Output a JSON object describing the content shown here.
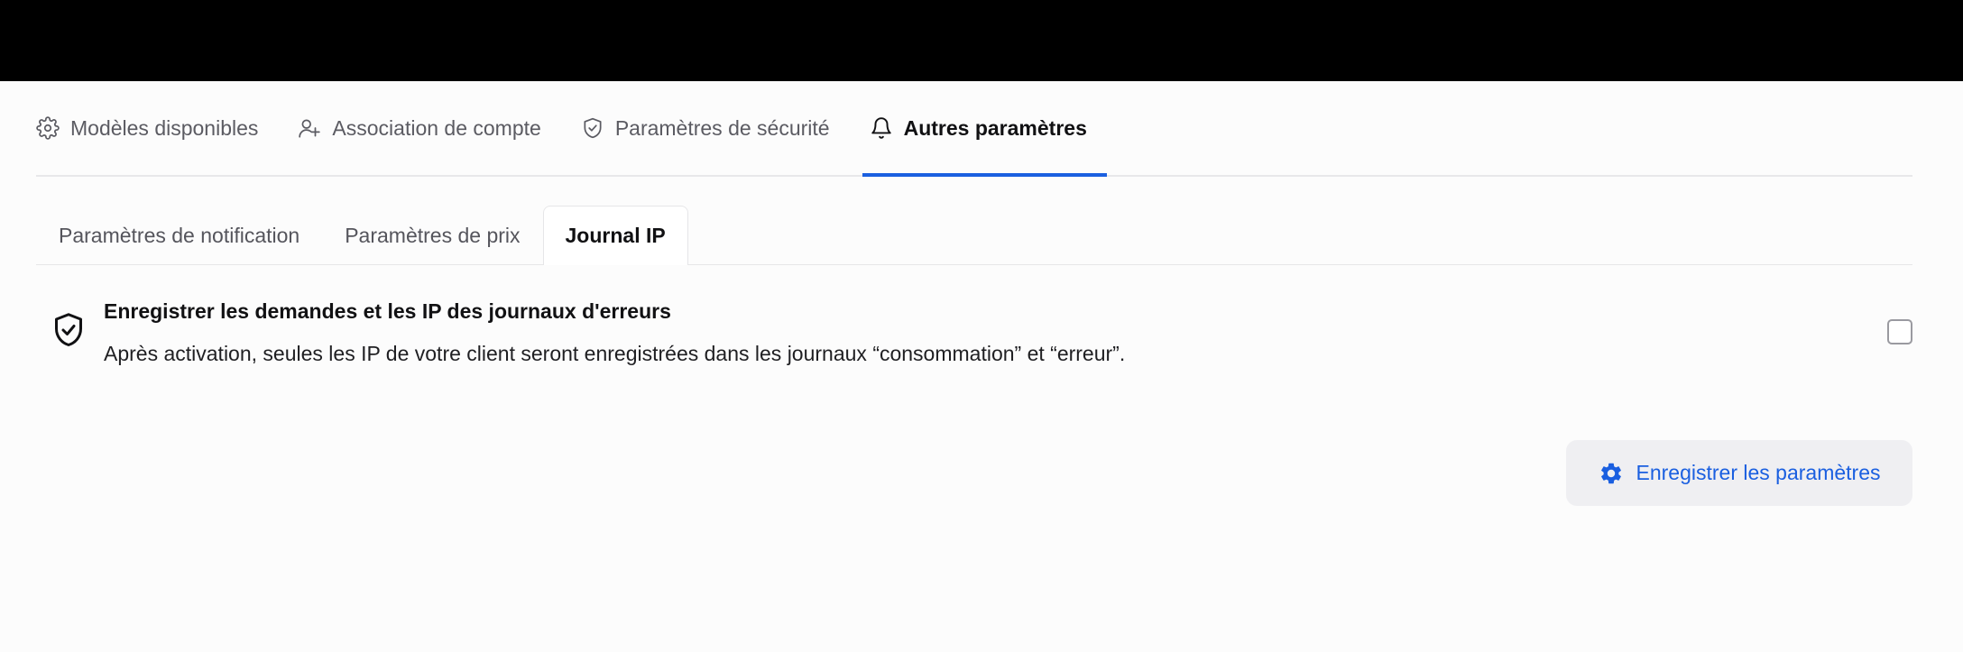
{
  "main_tabs": [
    {
      "label": "Modèles disponibles",
      "icon": "gear-icon",
      "active": false
    },
    {
      "label": "Association de compte",
      "icon": "user-plus-icon",
      "active": false
    },
    {
      "label": "Paramètres de sécurité",
      "icon": "shield-check-icon",
      "active": false
    },
    {
      "label": "Autres paramètres",
      "icon": "bell-icon",
      "active": true
    }
  ],
  "sub_tabs": [
    {
      "label": "Paramètres de notification",
      "active": false
    },
    {
      "label": "Paramètres de prix",
      "active": false
    },
    {
      "label": "Journal IP",
      "active": true
    }
  ],
  "setting": {
    "icon": "shield-check-icon",
    "title": "Enregistrer les demandes et les IP des journaux d'erreurs",
    "description": "Après activation, seules les IP de votre client seront enregistrées dans les journaux “consommation” et “erreur”.",
    "checked": false
  },
  "actions": {
    "save_label": "Enregistrer les paramètres",
    "save_icon": "gear-icon"
  },
  "colors": {
    "accent": "#1a5fe0",
    "top_bar": "#000000",
    "button_bg": "#efeff2"
  }
}
